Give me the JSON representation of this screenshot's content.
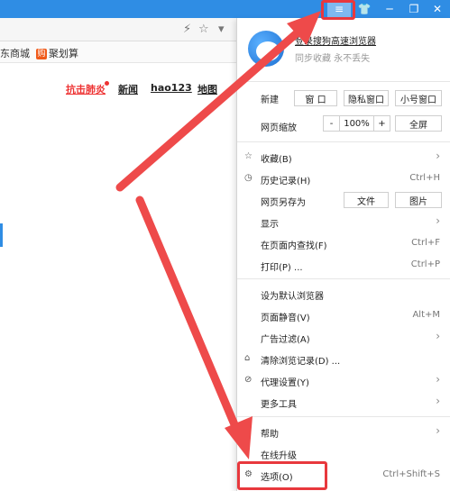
{
  "titlebar": {
    "menu_icon": "≡",
    "skin_icon": "👕",
    "min_icon": "─",
    "max_icon": "❐",
    "close_icon": "✕"
  },
  "addrbar": {
    "bolt_icon": "⚡",
    "star_icon": "☆",
    "dropdown_icon": "▾"
  },
  "favbar": {
    "item1": "东商城",
    "item2_badge": "购",
    "item2": "聚划算"
  },
  "page": {
    "link_hot": "抗击肺炎",
    "link_news": "新闻",
    "link_hao123": "hao123",
    "link_map": "地图"
  },
  "menu": {
    "profile_name": "登录搜狗高速浏览器",
    "profile_sub": "同步收藏 永不丢失",
    "new_label": "新建",
    "new_window": "窗 口",
    "new_private": "隐私窗口",
    "new_small": "小号窗口",
    "zoom_label": "网页缩放",
    "zoom_minus": "-",
    "zoom_value": "100%",
    "zoom_plus": "+",
    "fullscreen": "全屏",
    "favorites": "收藏(B)",
    "history": "历史记录(H)",
    "history_short": "Ctrl+H",
    "save_as": "网页另存为",
    "save_file": "文件",
    "save_image": "图片",
    "display": "显示",
    "find": "在页面内查找(F)",
    "find_short": "Ctrl+F",
    "print": "打印(P) ...",
    "print_short": "Ctrl+P",
    "default_browser": "设为默认浏览器",
    "mute": "页面静音(V)",
    "mute_short": "Alt+M",
    "adblock": "广告过滤(A)",
    "clear": "清除浏览记录(D) ...",
    "proxy": "代理设置(Y)",
    "more_tools": "更多工具",
    "help": "帮助",
    "upgrade": "在线升级",
    "options": "选项(O)",
    "options_short": "Ctrl+Shift+S",
    "arrow": "›",
    "star_icon": "☆",
    "clock_icon": "◷",
    "broom_icon": "⌂",
    "link_icon": "⊘",
    "gear_icon": "⚙"
  },
  "colors": {
    "titlebar": "#2f8de4",
    "highlight": "#e8383d"
  }
}
